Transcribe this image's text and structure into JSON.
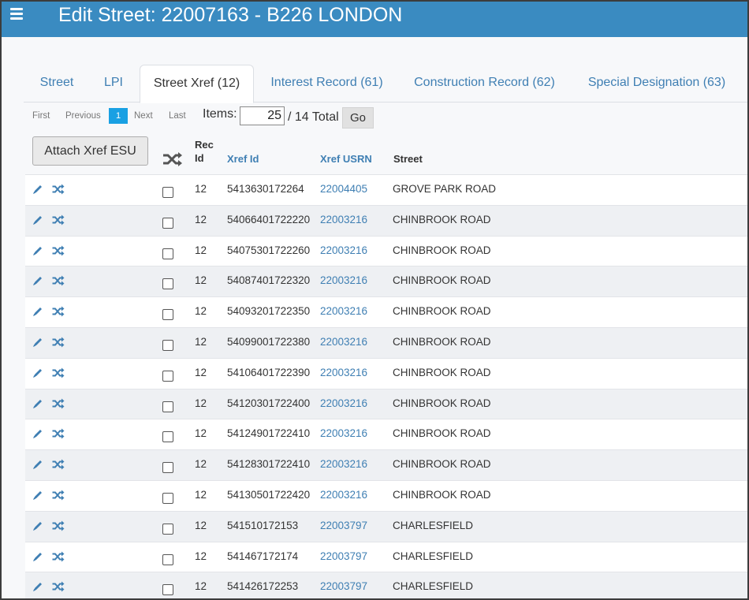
{
  "header": {
    "title": "Edit Street: 22007163 - B226 LONDON"
  },
  "tabs": [
    {
      "label": "Street"
    },
    {
      "label": "LPI"
    },
    {
      "label": "Street Xref (12)"
    },
    {
      "label": "Interest Record (61)"
    },
    {
      "label": "Construction Record (62)"
    },
    {
      "label": "Special Designation (63)"
    }
  ],
  "pager": {
    "first": "First",
    "previous": "Previous",
    "page": "1",
    "next": "Next",
    "last": "Last",
    "items_label": "Items:",
    "items_value": "25",
    "total": "/ 14 Total",
    "go": "Go"
  },
  "toolbar": {
    "attach_label": "Attach Xref ESU"
  },
  "table": {
    "headers": {
      "rec_id_1": "Rec",
      "rec_id_2": "Id",
      "xref_id": "Xref Id",
      "xref_usrn": "Xref USRN",
      "street": "Street"
    },
    "rows": [
      {
        "rec_id": "12",
        "xref_id": "5413630172264",
        "xref_usrn": "22004405",
        "street": "GROVE PARK ROAD"
      },
      {
        "rec_id": "12",
        "xref_id": "54066401722220",
        "xref_usrn": "22003216",
        "street": "CHINBROOK ROAD"
      },
      {
        "rec_id": "12",
        "xref_id": "54075301722260",
        "xref_usrn": "22003216",
        "street": "CHINBROOK ROAD"
      },
      {
        "rec_id": "12",
        "xref_id": "54087401722320",
        "xref_usrn": "22003216",
        "street": "CHINBROOK ROAD"
      },
      {
        "rec_id": "12",
        "xref_id": "54093201722350",
        "xref_usrn": "22003216",
        "street": "CHINBROOK ROAD"
      },
      {
        "rec_id": "12",
        "xref_id": "54099001722380",
        "xref_usrn": "22003216",
        "street": "CHINBROOK ROAD"
      },
      {
        "rec_id": "12",
        "xref_id": "54106401722390",
        "xref_usrn": "22003216",
        "street": "CHINBROOK ROAD"
      },
      {
        "rec_id": "12",
        "xref_id": "54120301722400",
        "xref_usrn": "22003216",
        "street": "CHINBROOK ROAD"
      },
      {
        "rec_id": "12",
        "xref_id": "54124901722410",
        "xref_usrn": "22003216",
        "street": "CHINBROOK ROAD"
      },
      {
        "rec_id": "12",
        "xref_id": "54128301722410",
        "xref_usrn": "22003216",
        "street": "CHINBROOK ROAD"
      },
      {
        "rec_id": "12",
        "xref_id": "54130501722420",
        "xref_usrn": "22003216",
        "street": "CHINBROOK ROAD"
      },
      {
        "rec_id": "12",
        "xref_id": "541510172153",
        "xref_usrn": "22003797",
        "street": "CHARLESFIELD"
      },
      {
        "rec_id": "12",
        "xref_id": "541467172174",
        "xref_usrn": "22003797",
        "street": "CHARLESFIELD"
      },
      {
        "rec_id": "12",
        "xref_id": "541426172253",
        "xref_usrn": "22003797",
        "street": "CHARLESFIELD"
      }
    ]
  },
  "icons": {
    "menu": "hamburger-menu-icon",
    "edit": "pencil-icon",
    "link": "shuffle-icon"
  },
  "colors": {
    "header_bg": "#3a8bc1",
    "link": "#3f7fb3",
    "active_page": "#19a0e3"
  }
}
